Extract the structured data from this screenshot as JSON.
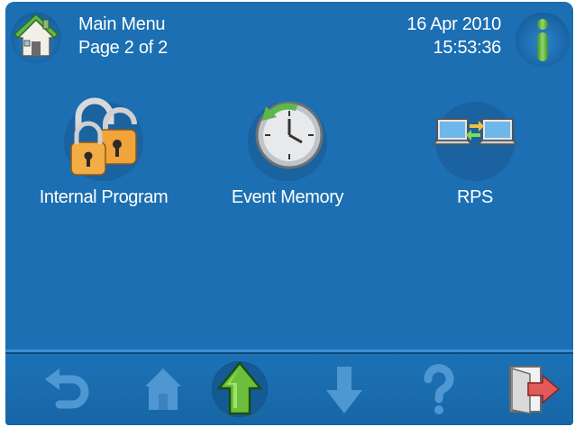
{
  "header": {
    "menu_title": "Main Menu",
    "page_indicator": "Page 2 of 2",
    "date": "16 Apr 2010",
    "time": "15:53:36"
  },
  "tiles": [
    {
      "label": "Internal Program",
      "icon": "padlock-open-icon"
    },
    {
      "label": "Event Memory",
      "icon": "clock-history-icon"
    },
    {
      "label": "RPS",
      "icon": "networked-laptops-icon"
    }
  ],
  "nav": [
    {
      "icon": "back-arrow-icon",
      "enabled": false
    },
    {
      "icon": "home-icon",
      "enabled": false
    },
    {
      "icon": "up-arrow-icon",
      "enabled": true
    },
    {
      "icon": "down-arrow-icon",
      "enabled": false
    },
    {
      "icon": "help-icon",
      "enabled": false
    },
    {
      "icon": "exit-icon",
      "enabled": true
    }
  ],
  "colors": {
    "background": "#1b6fb2",
    "text": "#ffffff",
    "disabled_icon": "#4f97d2",
    "up_arrow": "#6cbf3a",
    "exit_arrow": "#e05a5a"
  }
}
